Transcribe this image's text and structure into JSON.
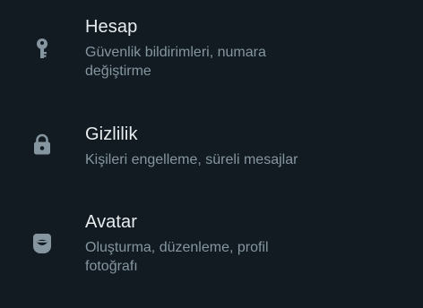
{
  "colors": {
    "background": "#111b21",
    "title": "#e9edef",
    "subtitle": "#8696a0",
    "icon": "#8696a0"
  },
  "settings": {
    "items": [
      {
        "icon": "key-icon",
        "title": "Hesap",
        "subtitle": "Güvenlik bildirimleri, numara değiştirme"
      },
      {
        "icon": "lock-icon",
        "title": "Gizlilik",
        "subtitle": "Kişileri engelleme, süreli mesajlar"
      },
      {
        "icon": "avatar-icon",
        "title": "Avatar",
        "subtitle": "Oluşturma, düzenleme, profil fotoğrafı"
      }
    ]
  }
}
